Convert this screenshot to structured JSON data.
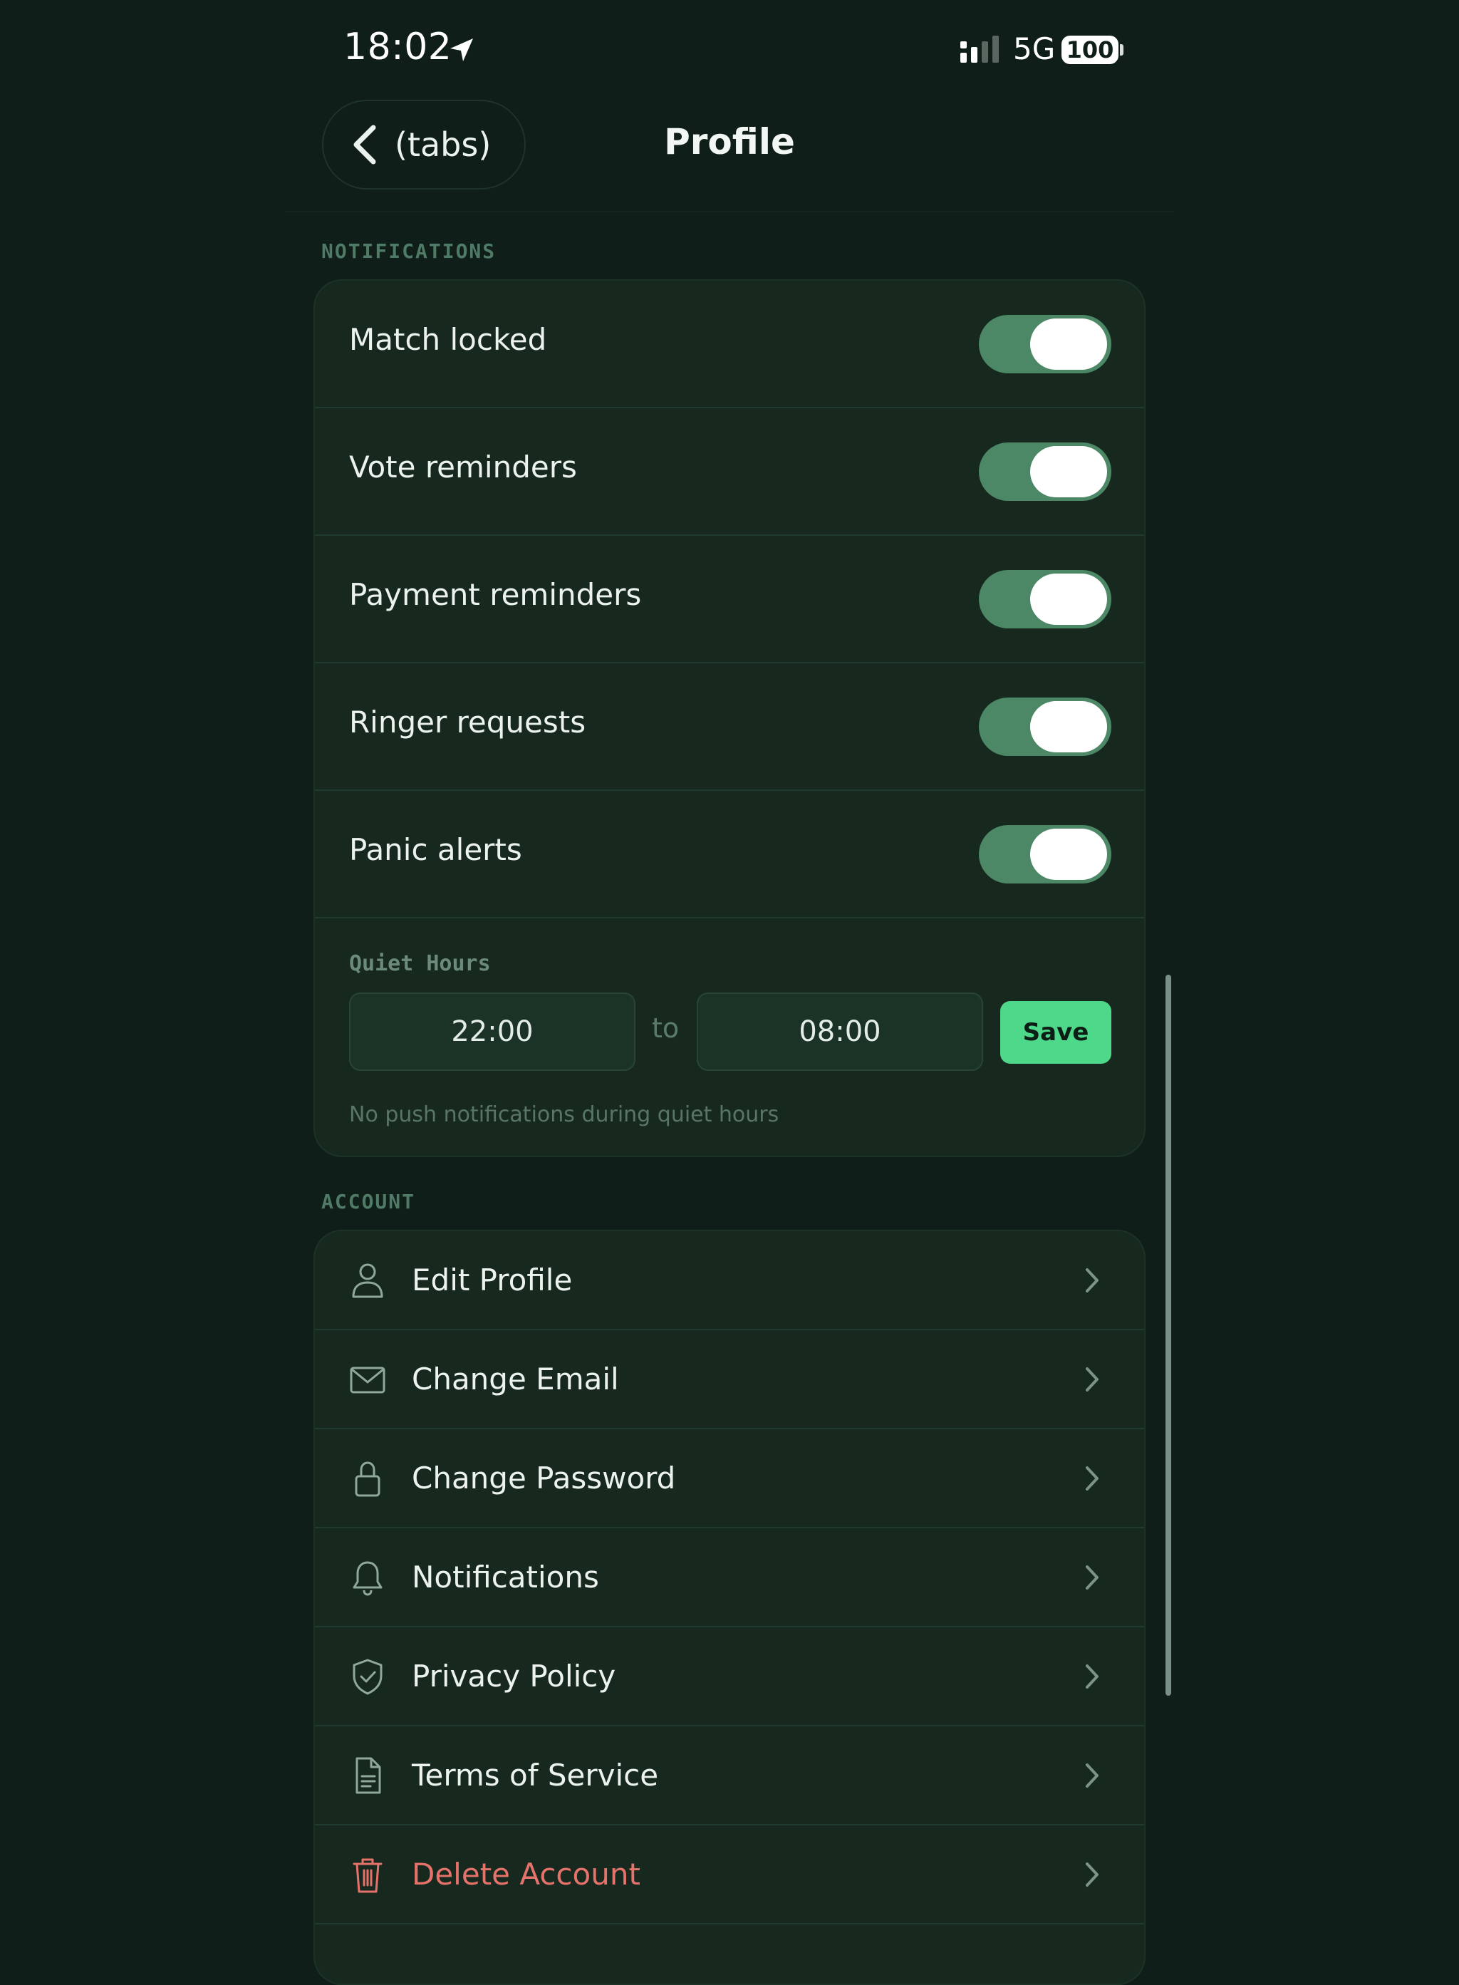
{
  "status_bar": {
    "time": "18:02",
    "network": "5G",
    "battery": "100"
  },
  "nav": {
    "back_label": "(tabs)",
    "title": "Profile"
  },
  "notifications": {
    "header": "NOTIFICATIONS",
    "toggles": [
      {
        "label": "Match locked",
        "on": true
      },
      {
        "label": "Vote reminders",
        "on": true
      },
      {
        "label": "Payment reminders",
        "on": true
      },
      {
        "label": "Ringer requests",
        "on": true
      },
      {
        "label": "Panic alerts",
        "on": true
      }
    ],
    "quiet_hours": {
      "label": "Quiet Hours",
      "start": "22:00",
      "separator": "to",
      "end": "08:00",
      "save_label": "Save",
      "hint": "No push notifications during quiet hours"
    }
  },
  "account": {
    "header": "ACCOUNT",
    "items": [
      {
        "label": "Edit Profile",
        "icon": "person-icon"
      },
      {
        "label": "Change Email",
        "icon": "envelope-icon"
      },
      {
        "label": "Change Password",
        "icon": "lock-icon"
      },
      {
        "label": "Notifications",
        "icon": "bell-icon"
      },
      {
        "label": "Privacy Policy",
        "icon": "shield-check-icon"
      },
      {
        "label": "Terms of Service",
        "icon": "document-icon"
      },
      {
        "label": "Delete Account",
        "icon": "trash-icon",
        "danger": true
      }
    ]
  },
  "colors": {
    "background": "#0f1e19",
    "card": "#17291f",
    "toggle_on": "#4c8766",
    "save_accent": "#4ed98a",
    "danger": "#e6736b"
  }
}
